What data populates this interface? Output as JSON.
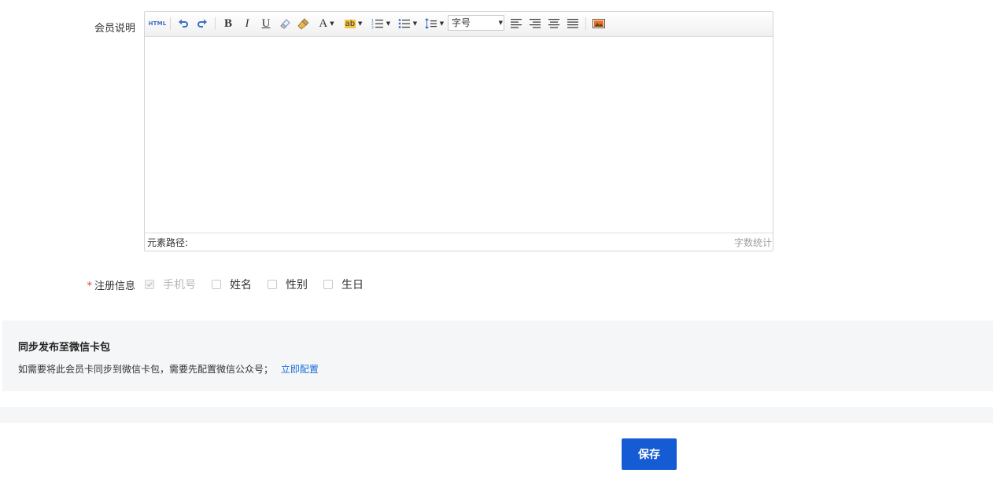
{
  "form": {
    "member_desc_label": "会员说明",
    "register_label": "注册信息",
    "required_mark": "*",
    "register_options": [
      {
        "label": "手机号",
        "checked": true,
        "disabled": true
      },
      {
        "label": "姓名",
        "checked": false,
        "disabled": false
      },
      {
        "label": "性别",
        "checked": false,
        "disabled": false
      },
      {
        "label": "生日",
        "checked": false,
        "disabled": false
      }
    ]
  },
  "editor": {
    "html_button": "HTML",
    "bold": "B",
    "italic": "I",
    "underline": "U",
    "font_color": "A",
    "highlight": "ab",
    "font_size_placeholder": "字号",
    "element_path_label": "元素路径:",
    "word_count_label": "字数统计"
  },
  "wechat": {
    "title": "同步发布至微信卡包",
    "description": "如需要将此会员卡同步到微信卡包，需要先配置微信公众号；",
    "link_text": "立即配置"
  },
  "footer": {
    "save_label": "保存"
  },
  "colors": {
    "primary": "#155bd4",
    "link": "#1a6cd6",
    "required": "#e4393c",
    "panel_bg": "#f5f6f7"
  }
}
